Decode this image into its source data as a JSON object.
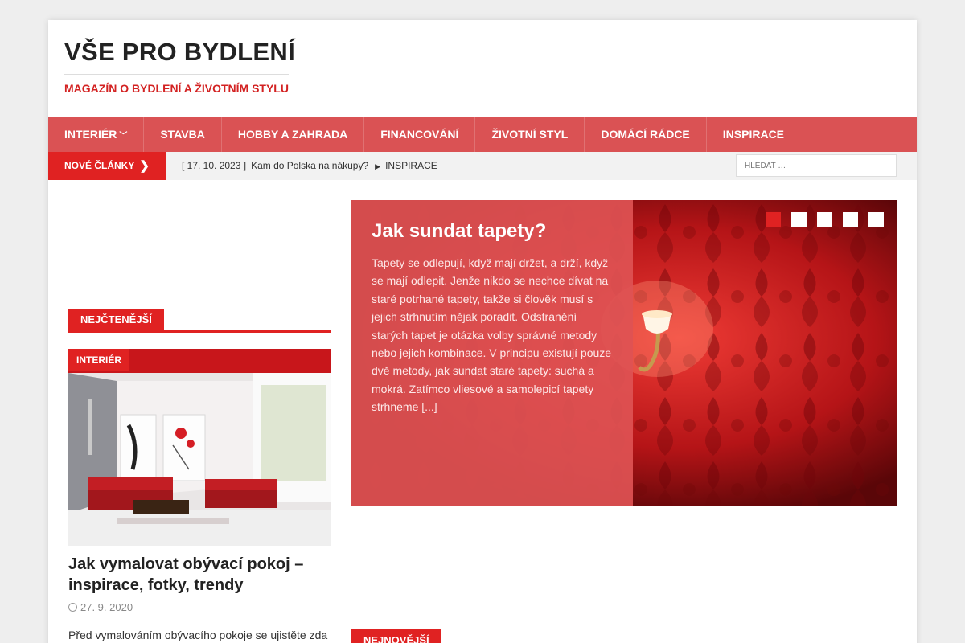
{
  "header": {
    "site_title": "VŠE PRO BYDLENÍ",
    "tagline": "MAGAZÍN O BYDLENÍ A ŽIVOTNÍM STYLU"
  },
  "nav": {
    "items": [
      {
        "label": "INTERIÉR",
        "has_submenu": true
      },
      {
        "label": "STAVBA"
      },
      {
        "label": "HOBBY A ZAHRADA"
      },
      {
        "label": "FINANCOVÁNÍ"
      },
      {
        "label": "ŽIVOTNÍ STYL"
      },
      {
        "label": "DOMÁCÍ RÁDCE"
      },
      {
        "label": "INSPIRACE"
      }
    ]
  },
  "ticker": {
    "label": "NOVÉ ČLÁNKY",
    "date": "[ 17. 10. 2023 ]",
    "headline": "Kam do Polska na nákupy?",
    "category": "INSPIRACE"
  },
  "search": {
    "placeholder": "HLEDAT …"
  },
  "left": {
    "section_label": "NEJČTENĚJŠÍ",
    "category_badge": "INTERIÉR",
    "post_title": "Jak vymalovat obývací pokoj – inspirace, fotky, trendy",
    "post_date": "27. 9. 2020",
    "post_excerpt": "Před vymalováním obývacího pokoje se ujistěte zda"
  },
  "slider": {
    "title": "Jak sundat tapety?",
    "text": "Tapety se odlepují, když mají držet, a drží, když se mají odlepit. Jenže nikdo se nechce dívat na staré potrhané tapety, takže si člověk musí s jejich strhnutím nějak poradit. Odstranění starých tapet je otázka volby správné metody nebo jejich kombinace. V principu existují pouze dvě metody, jak sundat staré tapety: suchá a mokrá. Zatímco vliesové a samolepicí tapety strhneme [...]",
    "active_slide": 1,
    "total_slides": 5
  },
  "bottom": {
    "section_label": "NEJNOVĚJŠÍ"
  },
  "colors": {
    "accent": "#e02222",
    "nav_bg": "#da5254",
    "page_bg": "#eeeeee"
  }
}
